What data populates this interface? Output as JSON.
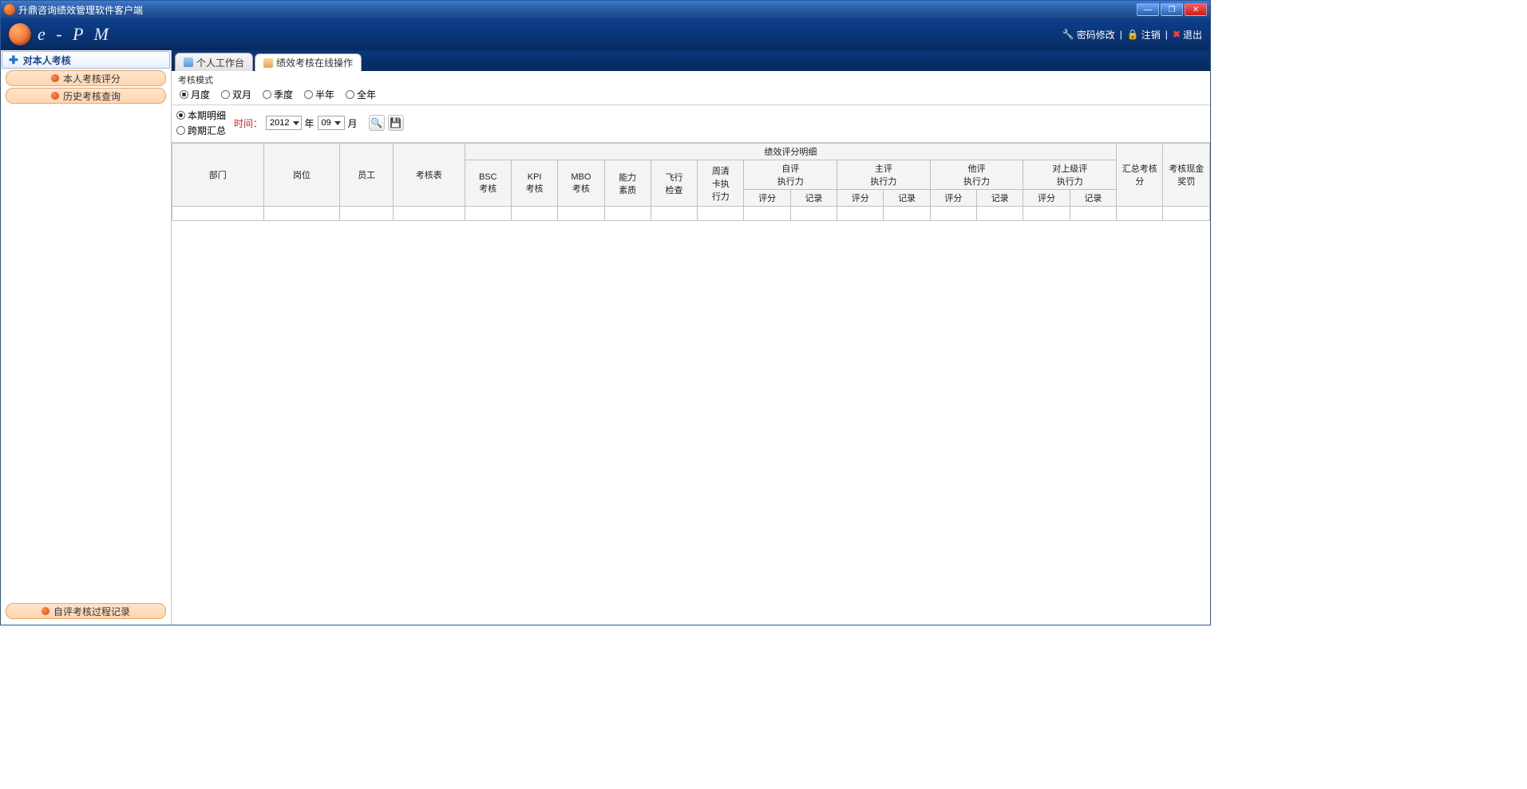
{
  "window": {
    "title": "升鼎咨询绩效管理软件客户端"
  },
  "brand": {
    "name": "e - P M"
  },
  "header_links": {
    "change_password": "密码修改",
    "logout": "注销",
    "exit": "退出"
  },
  "sidebar": {
    "header": "对本人考核",
    "items": [
      {
        "label": "本人考核评分"
      },
      {
        "label": "历史考核查询"
      }
    ],
    "footer_item": {
      "label": "自评考核过程记录"
    }
  },
  "tabs": [
    {
      "label": "个人工作台",
      "active": false
    },
    {
      "label": "绩效考核在线操作",
      "active": true
    }
  ],
  "mode": {
    "legend": "考核模式",
    "options": [
      "月度",
      "双月",
      "季度",
      "半年",
      "全年"
    ],
    "selected": "月度"
  },
  "period": {
    "detail_option": "本期明细",
    "summary_option": "跨期汇总",
    "selected": "本期明细",
    "time_label": "时间：",
    "year_value": "2012",
    "year_suffix": "年",
    "month_value": "09",
    "month_suffix": "月"
  },
  "table": {
    "group_header": "绩效评分明细",
    "cols": {
      "dept": "部门",
      "post": "岗位",
      "emp": "员工",
      "sheet": "考核表",
      "bsc": "BSC\n考核",
      "kpi": "KPI\n考核",
      "mbo": "MBO\n考核",
      "ability": "能力\n素质",
      "flight": "飞行\n检查",
      "weekly": "周清\n卡执\n行力",
      "self": "自评\n执行力",
      "lead": "主评\n执行力",
      "other": "他评\n执行力",
      "superior": "对上级评\n执行力",
      "score": "评分",
      "record": "记录",
      "total": "汇总考核分",
      "bonus": "考核现金奖罚"
    }
  }
}
